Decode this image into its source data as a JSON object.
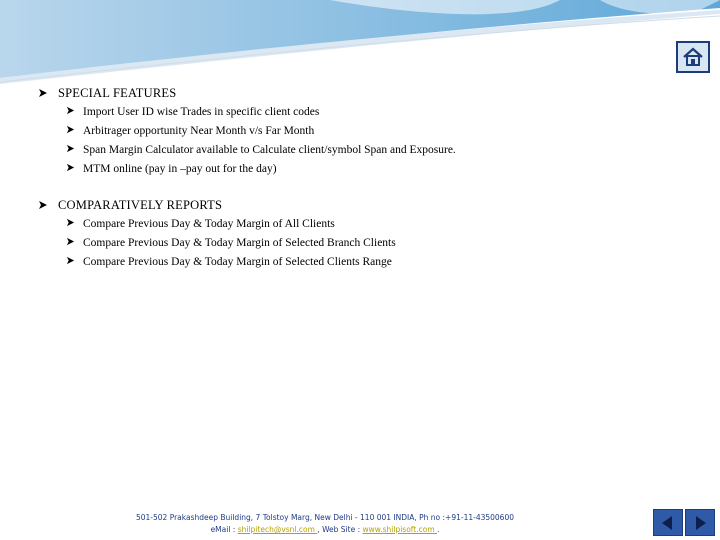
{
  "sections": [
    {
      "heading": "SPECIAL FEATURES",
      "items": [
        "Import User ID wise Trades in specific client codes",
        "Arbitrager opportunity Near Month v/s Far Month",
        "Span Margin Calculator available to Calculate client/symbol Span and Exposure.",
        "MTM online (pay in –pay out for the day)"
      ]
    },
    {
      "heading": "COMPARATIVELY REPORTS",
      "items": [
        "Compare Previous Day & Today Margin of All Clients",
        "Compare Previous Day & Today Margin of Selected Branch Clients",
        "Compare Previous Day & Today Margin of Selected Clients Range"
      ]
    }
  ],
  "footer": {
    "address": "501-502 Prakashdeep Building, 7 Tolstoy Marg, New Delhi - 110 001 INDIA, Ph no :+91-11-43500600",
    "email_label": "eMail :",
    "email": " shilpitech@vsnl.com ",
    "web_label": ", Web Site :",
    "website": " www.shilpisoft.com ",
    "end": "."
  },
  "icons": {
    "home": "home-icon",
    "back": "arrow-left-icon",
    "forward": "arrow-right-icon",
    "bullet": "arrowhead-bullet-icon"
  },
  "colors": {
    "accent": "#1c3d7a",
    "footer_text": "#1f3b8a",
    "link": "#b5a300",
    "nav_button": "#2f5aa8"
  }
}
